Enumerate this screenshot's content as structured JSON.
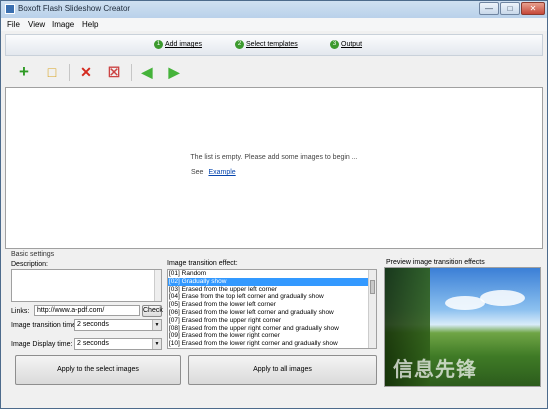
{
  "window": {
    "title": "Boxoft Flash Slideshow Creator"
  },
  "menu": [
    "File",
    "View",
    "Image",
    "Help"
  ],
  "steps": [
    {
      "num": "1",
      "label": "Add images"
    },
    {
      "num": "2",
      "label": "Select templates"
    },
    {
      "num": "3",
      "label": "Output"
    }
  ],
  "list": {
    "empty_message": "The list is empty. Please add some images to begin ...",
    "see_label": "See",
    "example_link": "Example"
  },
  "settings": {
    "section_title": "Basic settings",
    "description_label": "Description:",
    "links_label": "Links:",
    "links_value": "http://www.a-pdf.com/",
    "check_button": "Check",
    "transition_time_label": "Image transition time:",
    "transition_time_value": "2 seconds",
    "display_time_label": "Image Display time:",
    "display_time_value": "2 seconds",
    "effect_label": "Image transition effect:",
    "effects": [
      "[01] Random",
      "[02] Gradually show",
      "[03] Erased from the upper left corner",
      "[04] Erase from the top left corner and gradually show",
      "[05] Erased from the lower left corner",
      "[06] Erased from the lower left corner and gradually show",
      "[07] Erased from the upper right corner",
      "[08] Erased from the upper right corner and gradually show",
      "[09] Erased from the lower right corner",
      "[10] Erased from the lower right corner and gradually show"
    ],
    "selected_effect_index": 1,
    "preview_label": "Preview image transition effects"
  },
  "buttons": {
    "apply_selected": "Apply to the select images",
    "apply_all": "Apply to all images"
  },
  "watermark": "信息先锋"
}
